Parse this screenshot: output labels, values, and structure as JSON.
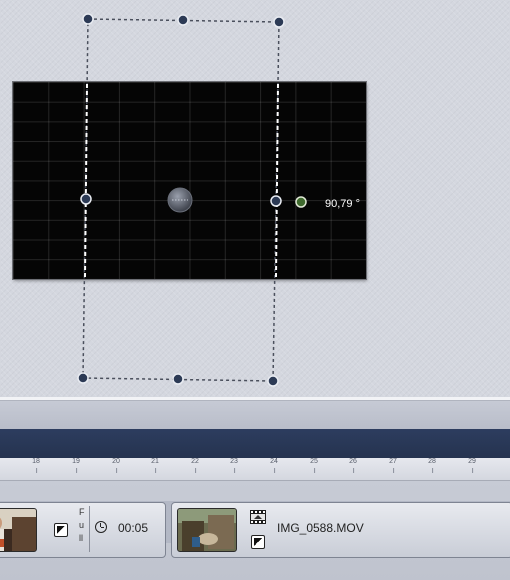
{
  "preview": {
    "rotation_angle": "90,79 °"
  },
  "timeline": {
    "ruler_ticks": [
      "18",
      "19",
      "20",
      "21",
      "22",
      "23",
      "24",
      "25",
      "26",
      "27",
      "28",
      "29"
    ]
  },
  "clips": [
    {
      "duration": "00:05",
      "scale_mode_label": "Full",
      "thumbnail_icon": "person-thumbnail",
      "effect_icon": "transition-fx-icon",
      "duration_icon": "clock-icon"
    },
    {
      "filename": "IMG_0588.MOV",
      "thumbnail_icon": "outdoor-video-thumbnail",
      "effect_icon": "transition-fx-icon",
      "media_icon": "filmstrip-icon"
    }
  ],
  "colors": {
    "canvas_bg": "#050505",
    "handle": "#2c3a55",
    "rotate_handle": "#3f6a2e",
    "timeline_dark": "#2d3d5f"
  }
}
